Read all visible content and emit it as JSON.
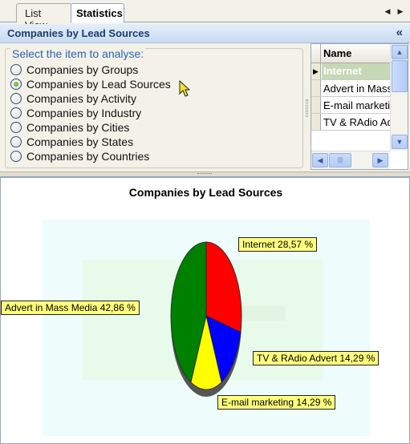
{
  "tabs": {
    "list_view": "List View",
    "statistics": "Statistics"
  },
  "header": {
    "title": "Companies by Lead Sources",
    "collapse_icon": "«"
  },
  "options": {
    "legend": "Select the item to analyse:",
    "items": [
      {
        "label": "Companies by Groups",
        "checked": false
      },
      {
        "label": "Companies by Lead Sources",
        "checked": true
      },
      {
        "label": "Companies by Activity",
        "checked": false
      },
      {
        "label": "Companies by Industry",
        "checked": false
      },
      {
        "label": "Companies by Cities",
        "checked": false
      },
      {
        "label": "Companies by States",
        "checked": false
      },
      {
        "label": "Companies by Countries",
        "checked": false
      }
    ]
  },
  "grid": {
    "column": "Name",
    "rows": [
      "Internet",
      "Advert in Mass Media",
      "E-mail marketing",
      "TV & RAdio Advert"
    ],
    "selected_row": 0
  },
  "chart_data": {
    "type": "pie",
    "title": "Companies by Lead Sources",
    "labels": [
      "Internet 28,57 %",
      "TV & RAdio Advert 14,29 %",
      "E-mail marketing 14,29 %",
      "Advert in Mass Media 42,86 %"
    ],
    "categories": [
      "Internet",
      "TV & RAdio Advert",
      "E-mail marketing",
      "Advert in Mass Media"
    ],
    "values": [
      28.57,
      14.29,
      14.29,
      42.86
    ],
    "colors": [
      "#ff0000",
      "#0000ff",
      "#ffff00",
      "#008000"
    ]
  }
}
